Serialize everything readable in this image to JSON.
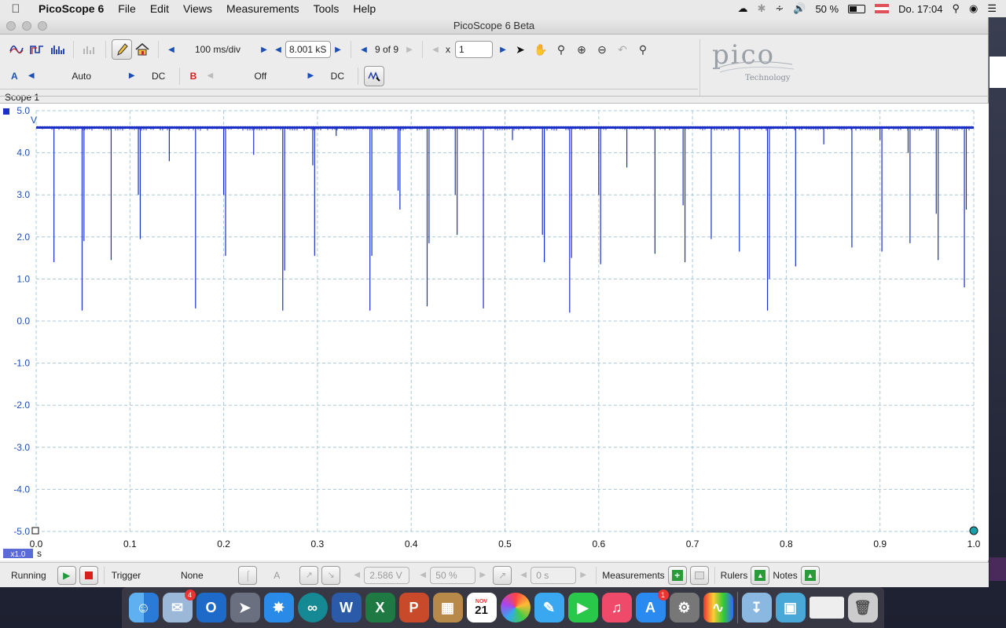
{
  "menubar": {
    "app": "PicoScope 6",
    "items": [
      "File",
      "Edit",
      "Views",
      "Measurements",
      "Tools",
      "Help"
    ],
    "battery": "50 %",
    "clock": "Do. 17:04"
  },
  "window": {
    "title": "PicoScope 6 Beta"
  },
  "toolbar": {
    "timebase": "100 ms/div",
    "samples": "8.001 kS",
    "buffer": "9 of 9",
    "zoom_prefix": "x",
    "zoom_value": "1"
  },
  "channels": {
    "a_label": "A",
    "a_range": "Auto",
    "a_coupling": "DC",
    "b_label": "B",
    "b_range": "Off",
    "b_coupling": "DC"
  },
  "logo": {
    "word": "pico",
    "sub": "Technology"
  },
  "scope": {
    "tab_label": "Scope 1",
    "y_unit": "V",
    "x_unit": "s",
    "zoom_badge": "x1.0"
  },
  "chart_data": {
    "type": "line",
    "x_ticks": [
      "0.0",
      "0.1",
      "0.2",
      "0.3",
      "0.4",
      "0.5",
      "0.6",
      "0.7",
      "0.8",
      "0.9",
      "1.0"
    ],
    "y_ticks": [
      "5.0",
      "4.0",
      "3.0",
      "2.0",
      "1.0",
      "0.0",
      "-1.0",
      "-2.0",
      "-3.0",
      "-4.0",
      "-5.0"
    ],
    "xlim": [
      0,
      1.0
    ],
    "ylim": [
      -5.0,
      5.0
    ],
    "grid": true,
    "series": [
      {
        "color": "#1a2fc8",
        "baseline": 4.6,
        "dips": [
          {
            "x": 0.019,
            "y": 1.4
          },
          {
            "x": 0.049,
            "y": 0.25
          },
          {
            "x": 0.051,
            "y": 1.9
          },
          {
            "x": 0.08,
            "y": 1.45
          },
          {
            "x": 0.109,
            "y": 3.0
          },
          {
            "x": 0.111,
            "y": 1.95
          },
          {
            "x": 0.142,
            "y": 3.8
          },
          {
            "x": 0.17,
            "y": 0.3
          },
          {
            "x": 0.2,
            "y": 3.0
          },
          {
            "x": 0.202,
            "y": 1.55
          },
          {
            "x": 0.232,
            "y": 3.95
          },
          {
            "x": 0.263,
            "y": 0.25
          },
          {
            "x": 0.265,
            "y": 1.2
          },
          {
            "x": 0.295,
            "y": 3.7
          },
          {
            "x": 0.297,
            "y": 1.55
          },
          {
            "x": 0.32,
            "y": 4.4
          },
          {
            "x": 0.356,
            "y": 0.25
          },
          {
            "x": 0.358,
            "y": 1.55
          },
          {
            "x": 0.386,
            "y": 3.1
          },
          {
            "x": 0.388,
            "y": 2.65
          },
          {
            "x": 0.417,
            "y": 0.35
          },
          {
            "x": 0.419,
            "y": 1.85
          },
          {
            "x": 0.447,
            "y": 3.0
          },
          {
            "x": 0.449,
            "y": 2.05
          },
          {
            "x": 0.477,
            "y": 0.3
          },
          {
            "x": 0.508,
            "y": 4.3
          },
          {
            "x": 0.54,
            "y": 2.05
          },
          {
            "x": 0.542,
            "y": 1.4
          },
          {
            "x": 0.569,
            "y": 0.2
          },
          {
            "x": 0.571,
            "y": 1.5
          },
          {
            "x": 0.6,
            "y": 3.0
          },
          {
            "x": 0.602,
            "y": 1.35
          },
          {
            "x": 0.63,
            "y": 3.65
          },
          {
            "x": 0.66,
            "y": 1.6
          },
          {
            "x": 0.69,
            "y": 2.75
          },
          {
            "x": 0.692,
            "y": 1.4
          },
          {
            "x": 0.72,
            "y": 1.95
          },
          {
            "x": 0.75,
            "y": 1.65
          },
          {
            "x": 0.78,
            "y": 0.25
          },
          {
            "x": 0.782,
            "y": 1.0
          },
          {
            "x": 0.81,
            "y": 1.3
          },
          {
            "x": 0.84,
            "y": 4.2
          },
          {
            "x": 0.87,
            "y": 1.75
          },
          {
            "x": 0.9,
            "y": 4.3
          },
          {
            "x": 0.902,
            "y": 1.65
          },
          {
            "x": 0.93,
            "y": 4.0
          },
          {
            "x": 0.932,
            "y": 1.85
          },
          {
            "x": 0.96,
            "y": 2.55
          },
          {
            "x": 0.962,
            "y": 1.45
          },
          {
            "x": 0.99,
            "y": 0.8
          },
          {
            "x": 0.992,
            "y": 2.65
          }
        ]
      }
    ]
  },
  "status": {
    "running": "Running",
    "trigger_label": "Trigger",
    "trigger_mode": "None",
    "trigger_channel": "A",
    "threshold": "2.586 V",
    "pre_trigger": "50 %",
    "delay": "0 s",
    "measurements": "Measurements",
    "rulers": "Rulers",
    "notes": "Notes"
  },
  "dock": {
    "calendar_month": "NOV",
    "calendar_day": "21",
    "mail_badge": "4",
    "appstore_badge": "1"
  }
}
